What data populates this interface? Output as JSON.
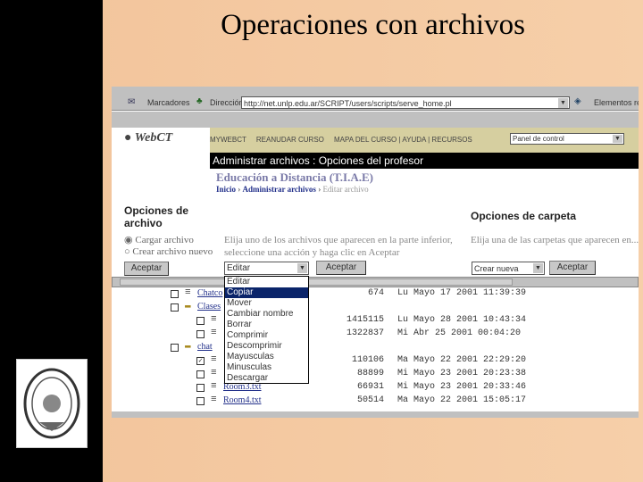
{
  "slide": {
    "title": "Operaciones con archivos"
  },
  "browser": {
    "links_label": "Marcadores",
    "address_label": "Dirección",
    "url": "http://net.unlp.edu.ar/SCRIPT/users/scripts/serve_home.pl",
    "elements_label": "Elementos re"
  },
  "webct": {
    "logo": "WebCT",
    "nav": [
      "MYWEBCT",
      "REANUDAR CURSO",
      "MAPA DEL CURSO",
      "AYUDA",
      "RECURSOS"
    ],
    "panel_select": "Panel de control",
    "banner": "Administrar archivos : Opciones del profesor",
    "course": "Educación a Distancia (T.I.A.E)",
    "breadcrumb": [
      "Inicio",
      "Administrar archivos",
      "Editar archivo"
    ],
    "file_options": {
      "title": "Opciones de archivo",
      "radios": [
        "Cargar archivo",
        "Crear archivo nuevo"
      ],
      "accept": "Aceptar",
      "instructions": "Elija uno de los archivos que aparecen en la parte inferior, seleccione una acción y haga clic en Aceptar",
      "action_select": "Editar",
      "accept2": "Aceptar"
    },
    "folder_options": {
      "title": "Opciones de carpeta",
      "instructions": "Elija una de las carpetas que aparecen en... seleccione una acción y haga clic en Acep...",
      "select": "Crear nueva",
      "accept": "Aceptar"
    },
    "dropdown": {
      "items": [
        "Editar",
        "Copiar",
        "Mover",
        "Cambiar nombre",
        "Borrar",
        "Comprimir",
        "Descomprimir",
        "Mayusculas",
        "Minusculas",
        "Descargar"
      ],
      "highlighted": 1
    },
    "files": [
      {
        "name": "Chatco",
        "type": "file",
        "size": "674",
        "date": "Lu Mayo 17 2001 11:39:39",
        "checked": false,
        "indent": 0
      },
      {
        "name": "Clases",
        "type": "folder",
        "size": "",
        "date": "",
        "checked": false,
        "indent": 0
      },
      {
        "name": "",
        "type": "file",
        "size": "1415115",
        "date": "Lu Mayo 28 2001 10:43:34",
        "checked": false,
        "indent": 1
      },
      {
        "name": "",
        "type": "file",
        "size": "1322837",
        "date": "Mi Abr 25 2001 00:04:20",
        "checked": false,
        "indent": 1
      },
      {
        "name": "chat",
        "type": "folder",
        "size": "",
        "date": "",
        "checked": false,
        "indent": 0
      },
      {
        "name": "",
        "type": "file",
        "size": "110106",
        "date": "Ma Mayo 22 2001 22:29:20",
        "checked": true,
        "indent": 1
      },
      {
        "name": "",
        "type": "file",
        "size": "88899",
        "date": "Mi Mayo 23 2001 20:23:38",
        "checked": false,
        "indent": 1
      },
      {
        "name": "Room3.txt",
        "type": "file",
        "size": "66931",
        "date": "Mi Mayo 23 2001 20:33:46",
        "checked": false,
        "indent": 1
      },
      {
        "name": "Room4.txt",
        "type": "file",
        "size": "50514",
        "date": "Ma Mayo 22 2001 15:05:17",
        "checked": false,
        "indent": 1
      }
    ]
  }
}
